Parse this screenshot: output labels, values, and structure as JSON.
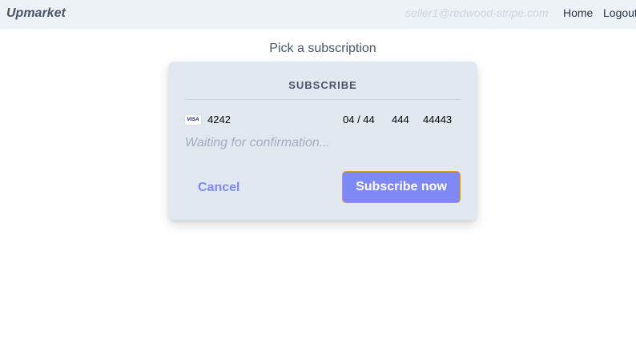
{
  "navbar": {
    "brand": "Upmarket",
    "user_email": "seller1@redwood-stripe.com",
    "links": {
      "home": "Home",
      "logout": "Logout"
    }
  },
  "main": {
    "heading": "Pick a subscription"
  },
  "subscribe_card": {
    "title": "SUBSCRIBE",
    "card_brand_icon": "visa-icon",
    "card_brand_text": "VISA",
    "card_last4": "4242",
    "card_expiry": "04 / 44",
    "card_cvc": "444",
    "card_zip": "44443",
    "status_text": "Waiting for confirmation...",
    "cancel_label": "Cancel",
    "subscribe_label": "Subscribe now"
  },
  "colors": {
    "accent": "#7f89f5",
    "navbar_bg": "#edf2f7",
    "card_bg": "#e2e8f0",
    "focus_ring": "#d69e2e"
  }
}
